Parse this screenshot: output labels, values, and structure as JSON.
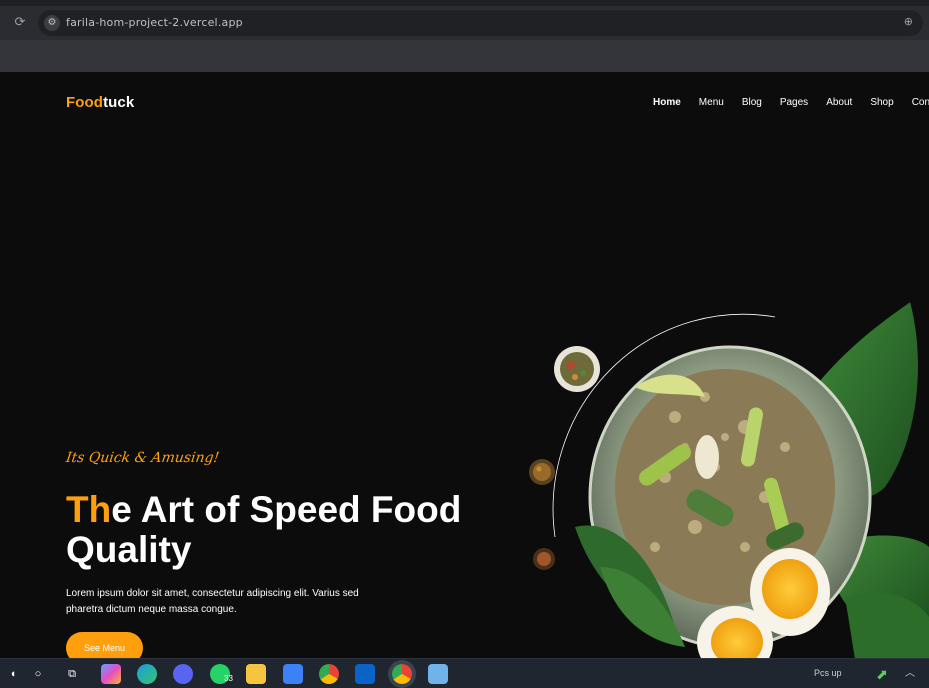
{
  "browser": {
    "url": "farila-hom-project-2.vercel.app",
    "reload_glyph": "⟳",
    "site_info_glyph": "⚙",
    "zoom_glyph": "⊕"
  },
  "site": {
    "logo_accent": "Food",
    "logo_rest": "tuck",
    "nav": [
      "Home",
      "Menu",
      "Blog",
      "Pages",
      "About",
      "Shop",
      "Contact"
    ]
  },
  "hero": {
    "script_tag": "Its Quick & Amusing!",
    "headline_accent": "Th",
    "headline_rest_line1": "e Art of Speed Food",
    "headline_line2": "Quality",
    "description": "Lorem ipsum dolor sit amet, consectetur adipiscing elit. Varius sed pharetra dictum neque massa congue.",
    "cta_label": "See Menu"
  },
  "taskbar": {
    "search_glyph": "○",
    "task_view_glyph": "⧉",
    "whatsapp_badge": "33",
    "weather_label": "Pcs up",
    "icons": [
      "copilot-icon",
      "edge-icon",
      "discord-icon",
      "whatsapp-icon",
      "file-explorer-icon",
      "store-icon",
      "chrome-icon",
      "outlook-icon",
      "chrome-active-icon",
      "notepad-icon"
    ]
  },
  "colors": {
    "accent": "#ff9f0d",
    "page_bg": "#0c0c0c",
    "chrome_bg": "#2b2c31",
    "taskbar_bg": "#20262f"
  }
}
